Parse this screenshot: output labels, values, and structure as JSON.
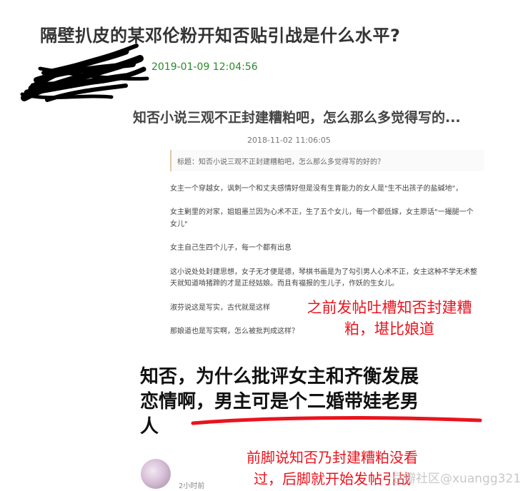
{
  "post": {
    "title": "隔壁扒皮的某邓伦粉开知否贴引战是什么水平?",
    "date": "2019-01-09 12:04:56"
  },
  "screenshot": {
    "title": "知否小说三观不正封建糟粕吧，怎么那么多觉得写的...",
    "date": "2018-11-02 11:06:05",
    "quote": "标题：知否小说三观不正封建糟粕吧，怎么那么多觉得写的好的？",
    "paragraphs": [
      "女主一个穿越女，讽刺一个和丈夫感情好但是没有生育能力的女人是\"生不出孩子的盐碱地\"，",
      "女主剿里的对家，姐姐墨兰因为心术不正，生了五个女儿，每一个都低嫁，女主原话\"一撮腿一个",
      "女儿\"",
      "女主自己生四个儿子，每一个都有出息",
      "这小说处处封建思想，女子无才便是德，琴棋书画是为了勾引男人心术不正，女主这种不学无术整",
      "天就知道啃猪蹄的才是正经姑娘。而且有福报的生儿子，作妖的生女儿。",
      "淑芬说这是写实，古代就是这样",
      "那娘道也是写实啊，怎么被批判成这样？"
    ]
  },
  "annotations": {
    "note_1": [
      "之前发帖吐槽知否封建糟",
      "粕，堪比娘道"
    ],
    "big_text": [
      "知否，为什么批评女主和齐衡发展",
      "恋情啊，男主可是个二婚带娃老男",
      "人"
    ],
    "note_2": [
      "前脚说知否乃封建糟粕没看",
      "过，后脚就开始发帖引战"
    ]
  },
  "comment": {
    "time_ago": "2小时前"
  },
  "watermark": "豆瓣社区@xuangg321",
  "colors": {
    "annotation_red": "#e8141e",
    "date_green": "#2a8a2a"
  }
}
